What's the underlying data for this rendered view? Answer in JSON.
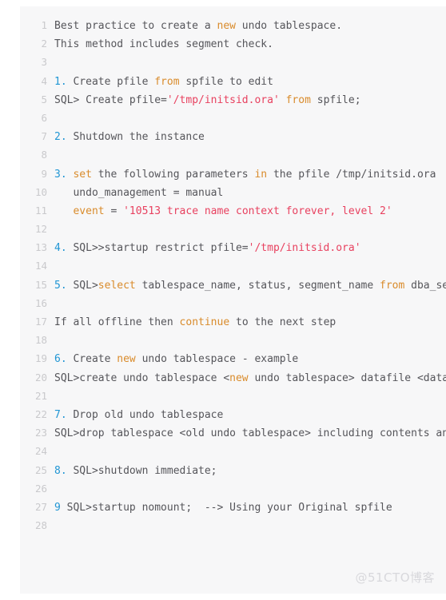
{
  "code_block": {
    "language": "sql",
    "colors": {
      "background": "#f7f7f8",
      "page_background": "#ffffff",
      "text": "#55555a",
      "line_number": "#c9c9cc",
      "list_marker": "#2196d4",
      "keyword": "#d98b2b",
      "string": "#e8415f",
      "watermark": "#d8d8dc"
    },
    "first_line_number": 1,
    "last_line_number": 28,
    "lines": [
      {
        "n": "1",
        "tokens": [
          {
            "t": "plain",
            "v": "Best practice to create a "
          },
          {
            "t": "kw",
            "v": "new"
          },
          {
            "t": "plain",
            "v": " undo tablespace."
          }
        ]
      },
      {
        "n": "2",
        "tokens": [
          {
            "t": "plain",
            "v": "This method includes segment check."
          }
        ]
      },
      {
        "n": "3",
        "tokens": []
      },
      {
        "n": "4",
        "tokens": [
          {
            "t": "num",
            "v": "1."
          },
          {
            "t": "plain",
            "v": " Create pfile "
          },
          {
            "t": "kw",
            "v": "from"
          },
          {
            "t": "plain",
            "v": " spfile to edit"
          }
        ]
      },
      {
        "n": "5",
        "tokens": [
          {
            "t": "plain",
            "v": "SQL> Create pfile="
          },
          {
            "t": "str",
            "v": "'/tmp/initsid.ora'"
          },
          {
            "t": "plain",
            "v": " "
          },
          {
            "t": "kw",
            "v": "from"
          },
          {
            "t": "plain",
            "v": " spfile;"
          }
        ]
      },
      {
        "n": "6",
        "tokens": []
      },
      {
        "n": "7",
        "tokens": [
          {
            "t": "num",
            "v": "2."
          },
          {
            "t": "plain",
            "v": " Shutdown the instance"
          }
        ]
      },
      {
        "n": "8",
        "tokens": []
      },
      {
        "n": "9",
        "tokens": [
          {
            "t": "num",
            "v": "3."
          },
          {
            "t": "plain",
            "v": " "
          },
          {
            "t": "kw",
            "v": "set"
          },
          {
            "t": "plain",
            "v": " the following parameters "
          },
          {
            "t": "kw",
            "v": "in"
          },
          {
            "t": "plain",
            "v": " the pfile /tmp/initsid.ora"
          }
        ]
      },
      {
        "n": "10",
        "tokens": [
          {
            "t": "plain",
            "v": "   undo_management = manual"
          }
        ]
      },
      {
        "n": "11",
        "tokens": [
          {
            "t": "plain",
            "v": "   "
          },
          {
            "t": "kw",
            "v": "event"
          },
          {
            "t": "plain",
            "v": " = "
          },
          {
            "t": "str",
            "v": "'10513 trace name context forever, level 2'"
          }
        ]
      },
      {
        "n": "12",
        "tokens": []
      },
      {
        "n": "13",
        "tokens": [
          {
            "t": "num",
            "v": "4."
          },
          {
            "t": "plain",
            "v": " SQL>>startup restrict pfile="
          },
          {
            "t": "str",
            "v": "'/tmp/initsid.ora'"
          }
        ]
      },
      {
        "n": "14",
        "tokens": []
      },
      {
        "n": "15",
        "tokens": [
          {
            "t": "num",
            "v": "5."
          },
          {
            "t": "plain",
            "v": " SQL>"
          },
          {
            "t": "kw",
            "v": "select"
          },
          {
            "t": "plain",
            "v": " tablespace_name, status, segment_name "
          },
          {
            "t": "kw",
            "v": "from"
          },
          {
            "t": "plain",
            "v": " dba_segments;"
          }
        ]
      },
      {
        "n": "16",
        "tokens": []
      },
      {
        "n": "17",
        "tokens": [
          {
            "t": "plain",
            "v": "If all offline then "
          },
          {
            "t": "kw",
            "v": "continue"
          },
          {
            "t": "plain",
            "v": " to the next step"
          }
        ]
      },
      {
        "n": "18",
        "tokens": []
      },
      {
        "n": "19",
        "tokens": [
          {
            "t": "num",
            "v": "6."
          },
          {
            "t": "plain",
            "v": " Create "
          },
          {
            "t": "kw",
            "v": "new"
          },
          {
            "t": "plain",
            "v": " undo tablespace - example"
          }
        ]
      },
      {
        "n": "20",
        "tokens": [
          {
            "t": "plain",
            "v": "SQL>create undo tablespace <"
          },
          {
            "t": "kw",
            "v": "new"
          },
          {
            "t": "plain",
            "v": " undo tablespace> datafile <datafile>"
          }
        ]
      },
      {
        "n": "21",
        "tokens": []
      },
      {
        "n": "22",
        "tokens": [
          {
            "t": "num",
            "v": "7."
          },
          {
            "t": "plain",
            "v": " Drop old undo tablespace"
          }
        ]
      },
      {
        "n": "23",
        "tokens": [
          {
            "t": "plain",
            "v": "SQL>drop tablespace <old undo tablespace> including contents and datafiles;"
          }
        ]
      },
      {
        "n": "24",
        "tokens": []
      },
      {
        "n": "25",
        "tokens": [
          {
            "t": "num",
            "v": "8."
          },
          {
            "t": "plain",
            "v": " SQL>shutdown immediate;"
          }
        ]
      },
      {
        "n": "26",
        "tokens": []
      },
      {
        "n": "27",
        "tokens": [
          {
            "t": "num",
            "v": "9"
          },
          {
            "t": "plain",
            "v": " SQL>startup nomount;  --> Using your Original spfile"
          }
        ]
      },
      {
        "n": "28",
        "tokens": []
      }
    ]
  },
  "watermark": {
    "text": "@51CTO博客"
  }
}
